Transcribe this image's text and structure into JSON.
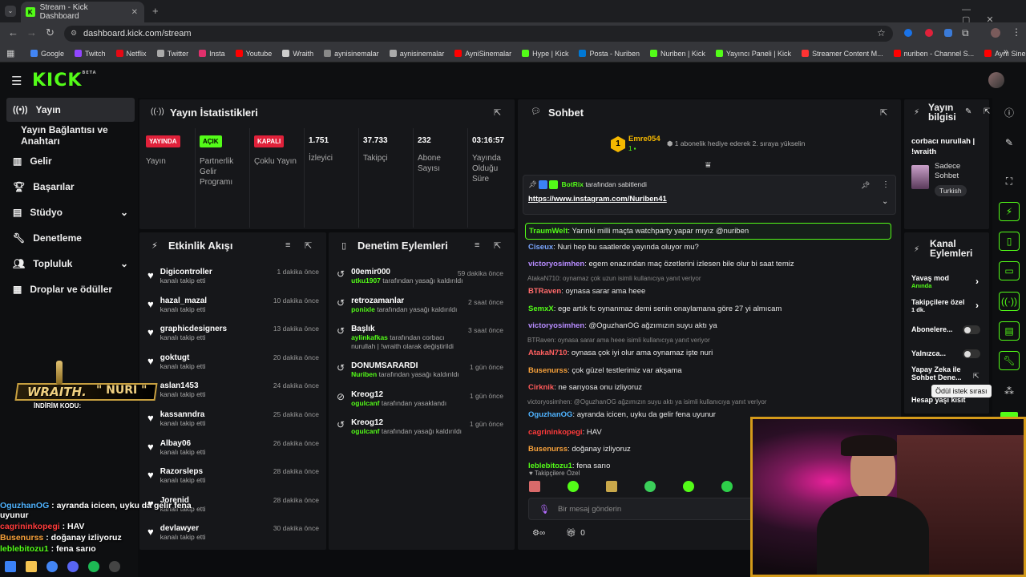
{
  "browser": {
    "tab_title": "Stream - Kick Dashboard",
    "url": "dashboard.kick.com/stream",
    "bookmarks": [
      {
        "label": "Google",
        "color": "#4285f4"
      },
      {
        "label": "Twitch",
        "color": "#9146ff"
      },
      {
        "label": "Netflix",
        "color": "#e50914"
      },
      {
        "label": "Twitter",
        "color": "#aaaaaa"
      },
      {
        "label": "Insta",
        "color": "#e1306c"
      },
      {
        "label": "Youtube",
        "color": "#ff0000"
      },
      {
        "label": "Wraith",
        "color": "#cccccc"
      },
      {
        "label": "aynisinemalar",
        "color": "#888888"
      },
      {
        "label": "aynisinemalar",
        "color": "#aaaaaa"
      },
      {
        "label": "AyniSinemalar",
        "color": "#ff0000"
      },
      {
        "label": "Hype | Kick",
        "color": "#53fc18"
      },
      {
        "label": "Posta - Nuriben",
        "color": "#0078d4"
      },
      {
        "label": "Nuriben | Kick",
        "color": "#53fc18"
      },
      {
        "label": "Yayıncı Paneli | Kick",
        "color": "#53fc18"
      },
      {
        "label": "Streamer Content M...",
        "color": "#ff3333"
      },
      {
        "label": "nuriben - Channel S...",
        "color": "#ff0000"
      },
      {
        "label": "Aynı Sinemalar - Ça...",
        "color": "#ff0000"
      }
    ]
  },
  "kick": {
    "logo_text": "KICK",
    "beta": "BETA"
  },
  "sidebar": {
    "items": [
      {
        "label": "Yayın"
      },
      {
        "label": "Yayın Bağlantısı ve Anahtarı"
      },
      {
        "label": "Gelir"
      },
      {
        "label": "Başarılar"
      },
      {
        "label": "Stüdyo"
      },
      {
        "label": "Denetleme"
      },
      {
        "label": "Topluluk"
      },
      {
        "label": "Droplar ve ödüller"
      }
    ]
  },
  "stats": {
    "title": "Yayın İstatistikleri",
    "cols": [
      {
        "badge": "YAYINDA",
        "badge_color": "#e0213a",
        "label": "Yayın"
      },
      {
        "badge": "AÇIK",
        "badge_color": "#53fc18",
        "label": "Partnerlik Gelir Programı"
      },
      {
        "badge": "KAPALI",
        "badge_color": "#e0213a",
        "label": "Çoklu Yayın"
      },
      {
        "value": "1.751",
        "label": "İzleyici"
      },
      {
        "value": "37.733",
        "label": "Takipçi"
      },
      {
        "value": "232",
        "label": "Abone Sayısı"
      },
      {
        "value": "03:16:57",
        "label": "Yayında Olduğu Süre"
      }
    ]
  },
  "activity": {
    "title": "Etkinlik Akışı",
    "items": [
      {
        "name": "Digicontroller",
        "sub": "kanalı takip etti",
        "time": "1 dakika önce"
      },
      {
        "name": "hazal_mazal",
        "sub": "kanalı takip etti",
        "time": "10 dakika önce"
      },
      {
        "name": "graphicdesigners",
        "sub": "kanalı takip etti",
        "time": "13 dakika önce"
      },
      {
        "name": "goktugt",
        "sub": "kanalı takip etti",
        "time": "20 dakika önce"
      },
      {
        "name": "aslan1453",
        "sub": "kanalı takip etti",
        "time": "24 dakika önce"
      },
      {
        "name": "kassanndra",
        "sub": "kanalı takip etti",
        "time": "25 dakika önce"
      },
      {
        "name": "Albay06",
        "sub": "kanalı takip etti",
        "time": "26 dakika önce"
      },
      {
        "name": "Razorsleps",
        "sub": "kanalı takip etti",
        "time": "28 dakika önce"
      },
      {
        "name": "Jorenid",
        "sub": "kanalı takip etti",
        "time": "28 dakika önce"
      },
      {
        "name": "devlawyer",
        "sub": "kanalı takip etti",
        "time": "30 dakika önce"
      }
    ]
  },
  "moderation": {
    "title": "Denetim Eylemleri",
    "items": [
      {
        "name": "00emir000",
        "who": "utku1907",
        "action": "tarafından yasağı kaldırıldı",
        "time": "59 dakika önce"
      },
      {
        "name": "retrozamanlar",
        "who": "ponixle",
        "action": "tarafından yasağı kaldırıldı",
        "time": "2 saat önce"
      },
      {
        "name": "Başlık",
        "who": "aylinkafkas",
        "action": "tarafından corbacı nurullah | !wraith olarak değiştirildi",
        "time": "3 saat önce"
      },
      {
        "name": "DONUMSARARDI",
        "who": "Nuriben",
        "action": "tarafından yasağı kaldırıldı",
        "time": "1 gün önce"
      },
      {
        "name": "Kreog12",
        "who": "ogulcanf",
        "action": "tarafından yasaklandı",
        "time": "1 gün önce"
      },
      {
        "name": "Kreog12",
        "who": "ogulcanf",
        "action": "tarafından yasağı kaldırıldı",
        "time": "1 gün önce"
      }
    ]
  },
  "chat": {
    "title": "Sohbet",
    "gift_user": "Emre054",
    "gift_count": "1",
    "gift_text": "1 abonelik hediye ederek 2. sıraya yükselin",
    "pinned_by": "BotRix",
    "pinned_by_suffix": "tarafından sabitlendi",
    "pinned_link": "https://www.instagram.com/Nuriben41",
    "messages": [
      {
        "reply": "",
        "user": "TraumWelt",
        "color": "#53fc18",
        "text": "Yarınki milli maçta watchparty yapar mıyız @nuriben",
        "highlight": true
      },
      {
        "reply": "",
        "user": "Ciseux",
        "color": "#7aa6ff",
        "text": "Nuri hep bu saatlerde yayında oluyor mu?"
      },
      {
        "reply": "",
        "user": "victoryosimhen",
        "color": "#b78cff",
        "text": "egem enazından maç özetlerini izlesen bile olur bi saat temiz"
      },
      {
        "reply": "AtakaN710: oynamaz çok uzun isimli kullanıcıya yanıt veriyor",
        "user": "BTRaven",
        "color": "#ff6b6b",
        "text": "oynasa sarar ama heee"
      },
      {
        "reply": "",
        "user": "SemxX",
        "color": "#53fc18",
        "text": "ege artık fc oynanmaz demi senin onaylamana göre 27 yi almıcam"
      },
      {
        "reply": "",
        "user": "victoryosimhen",
        "color": "#b78cff",
        "text": "@OguzhanOG ağzımızın suyu aktı ya"
      },
      {
        "reply": "BTRaven: oynasa sarar ama heee isimli kullanıcıya yanıt veriyor",
        "user": "AtakaN710",
        "color": "#ff5f5f",
        "text": "oynasa çok iyi olur ama oynamaz işte nuri"
      },
      {
        "reply": "",
        "user": "Busenurss",
        "color": "#f7a13b",
        "text": "çok güzel testlerimiz var akşama"
      },
      {
        "reply": "",
        "user": "Cirknik",
        "color": "#ff5a5a",
        "text": "ne sarıyosa onu izliyoruz"
      },
      {
        "reply": "victoryosimhen: @OguzhanOG ağzımızın suyu aktı ya isimli kullanıcıya yanıt veriyor",
        "user": "OguzhanOG",
        "color": "#4fb3ff",
        "text": "ayranda icicen, uyku da gelir fena uyunur"
      },
      {
        "reply": "",
        "user": "cagrininkopegi",
        "color": "#ff3b3b",
        "text": "HAV"
      },
      {
        "reply": "",
        "user": "Busenurss",
        "color": "#f7a13b",
        "text": "doğanay izliyoruz"
      },
      {
        "reply": "",
        "user": "leblebitozu1",
        "color": "#53fc18",
        "text": "fena sarıo"
      }
    ],
    "followers_only": "Takipçilere Özel",
    "input_placeholder": "Bir mesaj gönderin",
    "points": "0"
  },
  "stream_info": {
    "title": "Yayın bilgisi",
    "stream_title": "corbacı nurullah | !wraith",
    "category": "Sadece Sohbet",
    "tag": "Turkish"
  },
  "channel_actions": {
    "title": "Kanal Eylemleri",
    "items": [
      {
        "label": "Yavaş mod",
        "sub": "Anında"
      },
      {
        "label": "Takipçilere özel",
        "sub": "1 dk."
      },
      {
        "label": "Abonelere...",
        "sub": ""
      },
      {
        "label": "Yalnızca...",
        "sub": ""
      },
      {
        "label": "Yapay Zeka ile Sohbet Dene...",
        "sub": ""
      },
      {
        "label": "Hesap yaşı kısıt",
        "sub": ""
      }
    ],
    "tooltip": "Ödül istek sırası"
  },
  "overlay": {
    "wraith_brand": "WRAITH.",
    "discount_label": "İNDİRİM KODU:",
    "discount_code": "\" NURI \"",
    "chat": [
      {
        "user": "OguzhanOG",
        "color": "#4fb3ff",
        "text": "ayranda icicen, uyku da gelir fena uyunur"
      },
      {
        "user": "cagrininkopegi",
        "color": "#ff3b3b",
        "text": "HAV"
      },
      {
        "user": "Busenurss",
        "color": "#f7a13b",
        "text": "doğanay izliyoruz"
      },
      {
        "user": "leblebitozu1",
        "color": "#53fc18",
        "text": "fena sarıo"
      }
    ]
  }
}
